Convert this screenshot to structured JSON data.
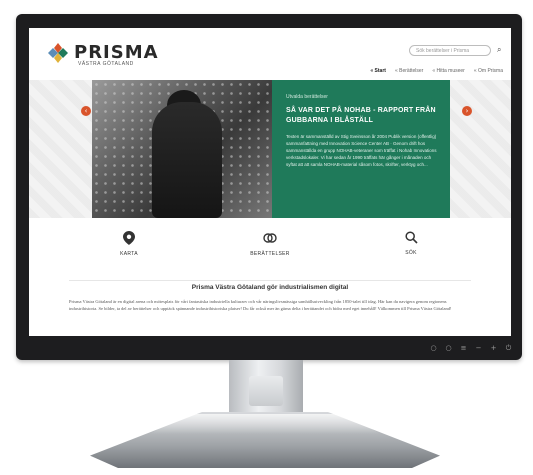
{
  "site": {
    "logo_name": "PRISMA",
    "logo_sub": "VÄSTRA GÖTALAND",
    "search_placeholder": "Sök berättelser i Prisma",
    "nav": [
      "« Start",
      "« Berättelser",
      "« Hitta museer",
      "« Om Prisma"
    ]
  },
  "hero": {
    "kicker": "Utvalda berättelser",
    "title": "SÅ VAR DET PÅ NOHAB - RAPPORT FRÅN GUBBARNA I BLÅSTÄLL",
    "text": "Texten är sammanställd av Stig Sveinsson år 2004 Publik version (offentlig) sammanfattning med Innovation Science Center AB · Genom drift hos sammanställda en grupp NOHAB-veteraner som träffat i Nohab Innovations verkstadslokaler. Vi har sedan år 1990 träffats här gånger i månaden och syftat att att samla NOHAB-material såsom fotos, skrifter, verktyg och..."
  },
  "features": [
    {
      "icon": "map-pin-icon",
      "label": "KARTA"
    },
    {
      "icon": "stories-icon",
      "label": "BERÄTTELSER"
    },
    {
      "icon": "search-icon",
      "label": "SÖK"
    }
  ],
  "intro": {
    "heading": "Prisma Västra Götaland gör industrialismen digital",
    "text": "Prisma Västra Götaland är en digital arena och mötesplats för vårt fantastiska industriella kulturarv och vår näringslivsmässiga samhällsutveckling från 1850-talet till idag. Här kan du navigera genom regionens industrihistoria. Se bilder, ta del av berättelser och upptäck spännande industrihistoriska platser! Du får också mer än gärna delta i berättandet och bidra med eget innehåll! Välkommen till Prisma Västra Götaland!"
  },
  "colors": {
    "accent_green": "#1f7a5a",
    "accent_orange": "#d9542b"
  }
}
